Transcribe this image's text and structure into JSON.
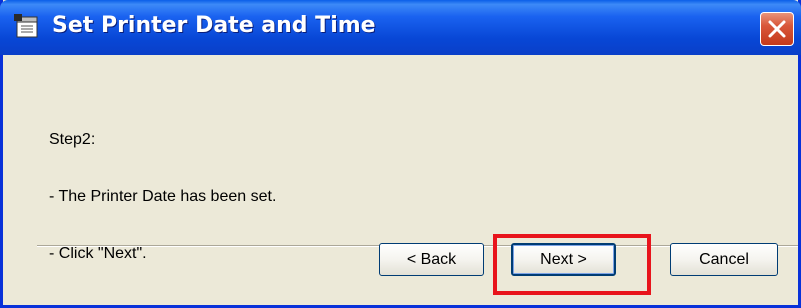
{
  "window": {
    "title": "Set Printer Date and Time",
    "icon": "printer-calendar-icon",
    "close_icon": "close-icon"
  },
  "content": {
    "lines": [
      "Step2:",
      "- The Printer Date has been set.",
      "- Click \"Next\"."
    ]
  },
  "buttons": {
    "back_label": "< Back",
    "next_label": "Next >",
    "cancel_label": "Cancel"
  },
  "colors": {
    "titlebar": "#0a47d6",
    "dialog_bg": "#ece9d8",
    "highlight": "#e8141c",
    "close_button": "#d9573a"
  }
}
